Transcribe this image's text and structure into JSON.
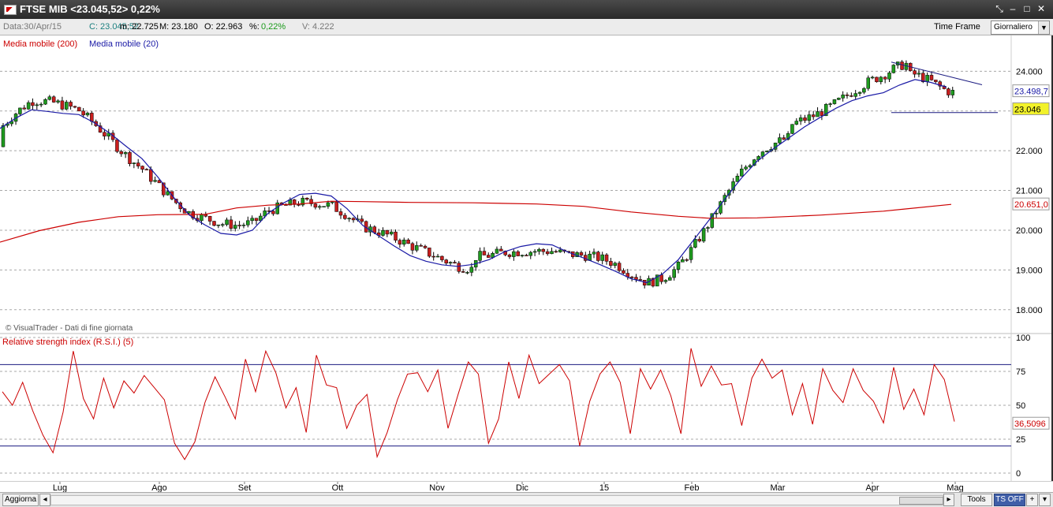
{
  "window": {
    "title": "FTSE MIB <23.045,52> 0,22%",
    "buttons": [
      "⤡",
      "–",
      "□",
      "✕"
    ]
  },
  "infobar": {
    "data": "Data:30/Apr/15",
    "close": "C: 23.045,52",
    "min": "m: 22.725",
    "max": "M: 23.180",
    "open": "O: 22.963",
    "pct_prefix": "%:",
    "pct_value": "0,22%",
    "volume": "V: 4.222",
    "timeframe_label": "Time Frame",
    "timeframe_value": "Giornaliero"
  },
  "legend": {
    "ma200": "Media mobile (200)",
    "ma20": "Media mobile (20)",
    "ma200_color": "#cc0000",
    "ma20_color": "#1a1aa6"
  },
  "watermark": "© VisualTrader - Dati di fine giornata",
  "price_axis": {
    "ticks": [
      "24.000",
      "23.000",
      "22.000",
      "21.000",
      "20.000",
      "19.000",
      "18.000"
    ],
    "labels": {
      "ma20": "23.498,7",
      "last": "23.046",
      "ma200": "20.651,0"
    }
  },
  "rsi": {
    "title": "Relative strength index (R.S.I.) (5)",
    "ticks": [
      "100",
      "75",
      "50",
      "25",
      "0"
    ],
    "last_label": "36,5096",
    "color": "#cc0000"
  },
  "x_axis": {
    "labels": [
      "Lug",
      "Ago",
      "Set",
      "Ott",
      "Nov",
      "Dic",
      "15",
      "Feb",
      "Mar",
      "Apr",
      "Mag"
    ]
  },
  "bottom": {
    "refresh": "Aggiorna",
    "tools": "Tools",
    "ts_off": "TS OFF",
    "plus": "+",
    "dropdown": "▾"
  },
  "chart_data": {
    "type": "candlestick",
    "price_range": [
      17400,
      24900
    ],
    "ma20": [
      [
        0,
        22560
      ],
      [
        20,
        22820
      ],
      [
        40,
        23030
      ],
      [
        60,
        22990
      ],
      [
        80,
        22940
      ],
      [
        100,
        22910
      ],
      [
        120,
        22700
      ],
      [
        140,
        22430
      ],
      [
        160,
        22110
      ],
      [
        180,
        21800
      ],
      [
        200,
        21340
      ],
      [
        220,
        20830
      ],
      [
        240,
        20380
      ],
      [
        260,
        20130
      ],
      [
        280,
        19920
      ],
      [
        300,
        19880
      ],
      [
        320,
        20000
      ],
      [
        340,
        20430
      ],
      [
        360,
        20690
      ],
      [
        380,
        20900
      ],
      [
        400,
        20930
      ],
      [
        420,
        20860
      ],
      [
        440,
        20540
      ],
      [
        460,
        20120
      ],
      [
        480,
        19860
      ],
      [
        500,
        19600
      ],
      [
        520,
        19360
      ],
      [
        540,
        19220
      ],
      [
        560,
        19130
      ],
      [
        580,
        19090
      ],
      [
        600,
        19140
      ],
      [
        620,
        19260
      ],
      [
        640,
        19460
      ],
      [
        660,
        19590
      ],
      [
        680,
        19660
      ],
      [
        700,
        19630
      ],
      [
        720,
        19450
      ],
      [
        740,
        19300
      ],
      [
        760,
        19140
      ],
      [
        780,
        18970
      ],
      [
        800,
        18780
      ],
      [
        820,
        18680
      ],
      [
        840,
        18900
      ],
      [
        860,
        19260
      ],
      [
        880,
        19770
      ],
      [
        900,
        20280
      ],
      [
        920,
        20810
      ],
      [
        940,
        21310
      ],
      [
        960,
        21740
      ],
      [
        980,
        22040
      ],
      [
        1000,
        22320
      ],
      [
        1020,
        22600
      ],
      [
        1040,
        22840
      ],
      [
        1060,
        23070
      ],
      [
        1080,
        23260
      ],
      [
        1100,
        23380
      ],
      [
        1120,
        23460
      ],
      [
        1140,
        23650
      ],
      [
        1160,
        23790
      ],
      [
        1180,
        23720
      ],
      [
        1200,
        23600
      ]
    ],
    "ma200": [
      [
        0,
        19700
      ],
      [
        50,
        19990
      ],
      [
        100,
        20200
      ],
      [
        150,
        20340
      ],
      [
        200,
        20390
      ],
      [
        260,
        20400
      ],
      [
        300,
        20560
      ],
      [
        340,
        20630
      ],
      [
        380,
        20660
      ],
      [
        420,
        20730
      ],
      [
        460,
        20720
      ],
      [
        520,
        20700
      ],
      [
        600,
        20690
      ],
      [
        680,
        20660
      ],
      [
        740,
        20600
      ],
      [
        800,
        20460
      ],
      [
        860,
        20350
      ],
      [
        900,
        20300
      ],
      [
        960,
        20310
      ],
      [
        1040,
        20380
      ],
      [
        1120,
        20480
      ],
      [
        1206,
        20650
      ]
    ],
    "trendlines": [
      {
        "from": [
          1130,
          24230
        ],
        "to": [
          1245,
          23660
        ]
      },
      {
        "from": [
          1130,
          22960
        ],
        "to": [
          1265,
          22960
        ]
      }
    ],
    "rsi_values": [
      60,
      50,
      67,
      46,
      28,
      15,
      45,
      90,
      55,
      40,
      70,
      48,
      68,
      59,
      72,
      63,
      54,
      22,
      10,
      23,
      52,
      71,
      56,
      40,
      84,
      60,
      90,
      74,
      48,
      63,
      30,
      87,
      65,
      63,
      33,
      50,
      58,
      12,
      30,
      54,
      73,
      74,
      60,
      76,
      33,
      58,
      82,
      73,
      22,
      40,
      82,
      55,
      87,
      66,
      73,
      80,
      68,
      20,
      53,
      73,
      82,
      67,
      29,
      77,
      62,
      76,
      57,
      29,
      92,
      64,
      79,
      65,
      66,
      35,
      70,
      84,
      70,
      76,
      43,
      66,
      36,
      77,
      61,
      52,
      77,
      61,
      53,
      37,
      78,
      47,
      62,
      43,
      80,
      69,
      38
    ],
    "rsi_range": [
      0,
      100
    ],
    "rsi_levels": [
      20,
      80
    ]
  }
}
